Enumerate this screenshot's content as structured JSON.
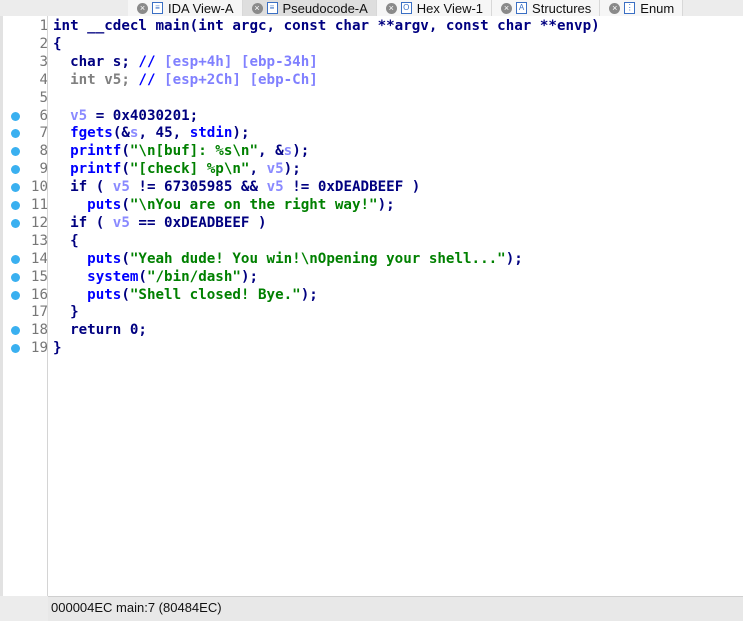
{
  "tabs": [
    {
      "label": "IDA View-A",
      "icon": "listing-icon",
      "active": false
    },
    {
      "label": "Pseudocode-A",
      "icon": "listing-icon",
      "active": true
    },
    {
      "label": "Hex View-1",
      "icon": "hex-icon",
      "active": false
    },
    {
      "label": "Structures",
      "icon": "structure-icon",
      "active": false
    },
    {
      "label": "Enum",
      "icon": "enum-icon",
      "active": false
    }
  ],
  "code": [
    {
      "n": "1",
      "bp": false,
      "t": [
        [
          "kw",
          "int __cdecl main(int argc, const char **argv, const char **envp)"
        ]
      ]
    },
    {
      "n": "2",
      "bp": false,
      "t": [
        [
          "kw",
          "{"
        ]
      ]
    },
    {
      "n": "3",
      "bp": false,
      "t": [
        [
          "kw",
          "  char s; "
        ],
        [
          "cmt",
          "// "
        ],
        [
          "cmt2",
          "[esp+4h] [ebp-34h]"
        ]
      ]
    },
    {
      "n": "4",
      "bp": false,
      "t": [
        [
          "gray",
          "  int v5; "
        ],
        [
          "cmt",
          "// "
        ],
        [
          "cmt2",
          "[esp+2Ch] [ebp-Ch]"
        ]
      ]
    },
    {
      "n": "5",
      "bp": false,
      "t": []
    },
    {
      "n": "6",
      "bp": true,
      "t": [
        [
          "kw",
          "  "
        ],
        [
          "var",
          "v5"
        ],
        [
          "kw",
          " = 0x4030201;"
        ]
      ]
    },
    {
      "n": "7",
      "bp": true,
      "t": [
        [
          "kw",
          "  "
        ],
        [
          "fn",
          "fgets"
        ],
        [
          "kw",
          "(&"
        ],
        [
          "var",
          "s"
        ],
        [
          "kw",
          ", 45, "
        ],
        [
          "fn",
          "stdin"
        ],
        [
          "kw",
          ");"
        ]
      ]
    },
    {
      "n": "8",
      "bp": true,
      "t": [
        [
          "kw",
          "  "
        ],
        [
          "fn",
          "printf"
        ],
        [
          "kw",
          "("
        ],
        [
          "str",
          "\"\\n[buf]: %s\\n\""
        ],
        [
          "kw",
          ", &"
        ],
        [
          "var",
          "s"
        ],
        [
          "kw",
          ");"
        ]
      ]
    },
    {
      "n": "9",
      "bp": true,
      "t": [
        [
          "kw",
          "  "
        ],
        [
          "fn",
          "printf"
        ],
        [
          "kw",
          "("
        ],
        [
          "str",
          "\"[check] %p\\n\""
        ],
        [
          "kw",
          ", "
        ],
        [
          "var",
          "v5"
        ],
        [
          "kw",
          ");"
        ]
      ]
    },
    {
      "n": "10",
      "bp": true,
      "t": [
        [
          "kw",
          "  if ( "
        ],
        [
          "var",
          "v5"
        ],
        [
          "kw",
          " != 67305985 && "
        ],
        [
          "var",
          "v5"
        ],
        [
          "kw",
          " != 0xDEADBEEF )"
        ]
      ]
    },
    {
      "n": "11",
      "bp": true,
      "t": [
        [
          "kw",
          "    "
        ],
        [
          "fn",
          "puts"
        ],
        [
          "kw",
          "("
        ],
        [
          "str",
          "\"\\nYou are on the right way!\""
        ],
        [
          "kw",
          ");"
        ]
      ]
    },
    {
      "n": "12",
      "bp": true,
      "t": [
        [
          "kw",
          "  if ( "
        ],
        [
          "var",
          "v5"
        ],
        [
          "kw",
          " == 0xDEADBEEF )"
        ]
      ]
    },
    {
      "n": "13",
      "bp": false,
      "t": [
        [
          "kw",
          "  {"
        ]
      ]
    },
    {
      "n": "14",
      "bp": true,
      "t": [
        [
          "kw",
          "    "
        ],
        [
          "fn",
          "puts"
        ],
        [
          "kw",
          "("
        ],
        [
          "str",
          "\"Yeah dude! You win!\\nOpening your shell...\""
        ],
        [
          "kw",
          ");"
        ]
      ]
    },
    {
      "n": "15",
      "bp": true,
      "t": [
        [
          "kw",
          "    "
        ],
        [
          "fn",
          "system"
        ],
        [
          "kw",
          "("
        ],
        [
          "str",
          "\"/bin/dash\""
        ],
        [
          "kw",
          ");"
        ]
      ]
    },
    {
      "n": "16",
      "bp": true,
      "t": [
        [
          "kw",
          "    "
        ],
        [
          "fn",
          "puts"
        ],
        [
          "kw",
          "("
        ],
        [
          "str",
          "\"Shell closed! Bye.\""
        ],
        [
          "kw",
          ");"
        ]
      ]
    },
    {
      "n": "17",
      "bp": false,
      "t": [
        [
          "kw",
          "  }"
        ]
      ]
    },
    {
      "n": "18",
      "bp": true,
      "t": [
        [
          "kw",
          "  return 0;"
        ]
      ]
    },
    {
      "n": "19",
      "bp": true,
      "t": [
        [
          "kw",
          "}"
        ]
      ]
    }
  ],
  "status": {
    "text": "000004EC  main:7 (80484EC)"
  },
  "colors": {
    "keyword": "#000080",
    "function": "#0000ff",
    "string": "#008000",
    "variable": "#8a8aff",
    "breakpoint_dot": "#3ab0f0"
  }
}
